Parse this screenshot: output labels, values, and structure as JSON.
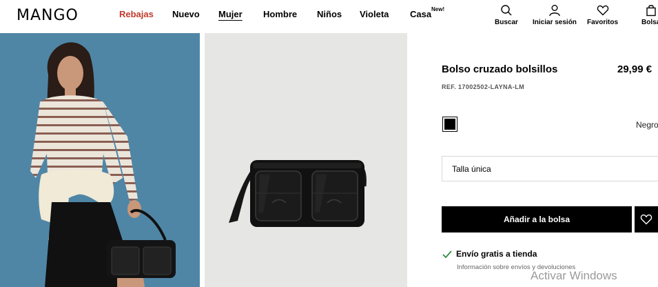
{
  "header": {
    "logo": "MANGO",
    "nav": [
      {
        "label": "Rebajas"
      },
      {
        "label": "Nuevo"
      },
      {
        "label": "Mujer"
      },
      {
        "label": "Hombre"
      },
      {
        "label": "Niños"
      },
      {
        "label": "Violeta"
      },
      {
        "label": "Casa",
        "badge": "New!"
      }
    ],
    "utilities": [
      {
        "label": "Buscar",
        "icon": "search-icon"
      },
      {
        "label": "Iniciar sesión",
        "icon": "user-icon"
      },
      {
        "label": "Favoritos",
        "icon": "heart-icon"
      },
      {
        "label": "Bolsa",
        "icon": "bag-icon"
      }
    ]
  },
  "product": {
    "title": "Bolso cruzado bolsillos",
    "price": "29,99 €",
    "ref": "REF. 17002502-LAYNA-LM",
    "color_name": "Negro",
    "swatch_color": "#000000",
    "size_label": "Talla única",
    "add_button": "Añadir a la bolsa",
    "shipping": "Envío gratis a tienda",
    "shipping_info": "Información sobre envíos y devoluciones"
  },
  "colors": {
    "sale": "#c0392b",
    "left_photo_bg": "#4f86a6",
    "right_photo_bg": "#e6e6e4"
  },
  "watermark": "Activar Windows"
}
